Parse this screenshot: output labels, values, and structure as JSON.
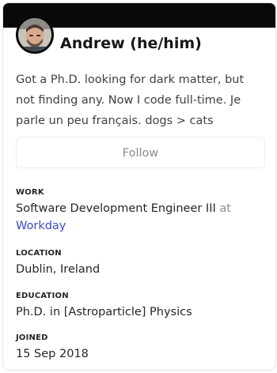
{
  "profile": {
    "name": "Andrew (he/him)",
    "bio": "Got a Ph.D. looking for dark matter, but not finding any. Now I code full-time. Je parle un peu français. dogs > cats",
    "follow_label": "Follow"
  },
  "details": {
    "work": {
      "label": "WORK",
      "title": "Software Development Engineer III",
      "at": "at",
      "company": "Workday"
    },
    "location": {
      "label": "LOCATION",
      "value": "Dublin, Ireland"
    },
    "education": {
      "label": "EDUCATION",
      "value": "Ph.D. in [Astroparticle] Physics"
    },
    "joined": {
      "label": "JOINED",
      "value": "15 Sep 2018"
    }
  },
  "colors": {
    "banner": "#090909",
    "link": "#3b49df",
    "muted": "#8f8f8f",
    "text": "#262626"
  },
  "icons": {
    "avatar": "avatar-photo"
  }
}
